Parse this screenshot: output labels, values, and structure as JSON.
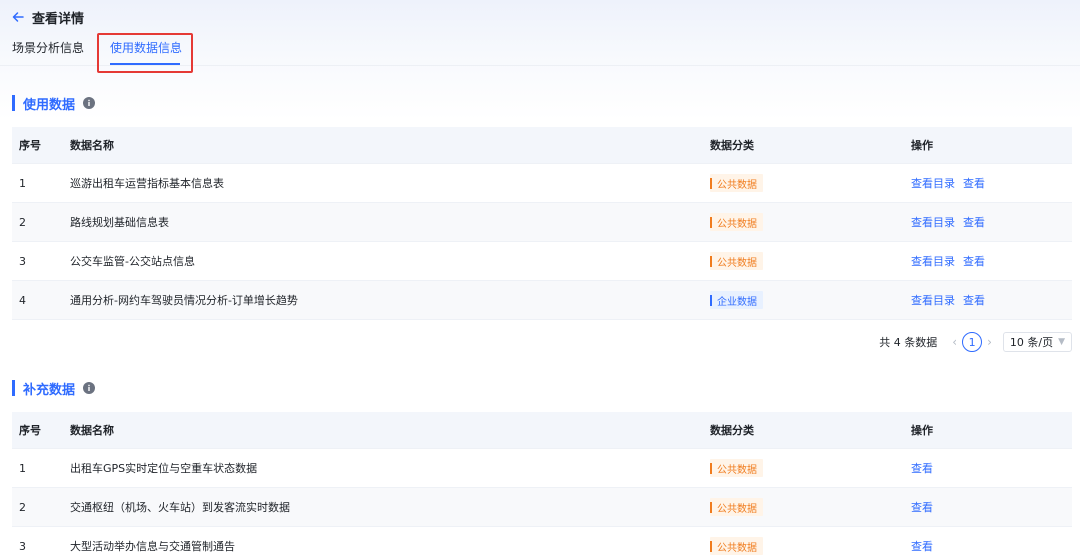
{
  "header": {
    "title": "查看详情"
  },
  "tabs": [
    {
      "label": "场景分析信息"
    },
    {
      "label": "使用数据信息"
    }
  ],
  "colors": {
    "accent": "#2f6bff",
    "public_tag": "#f07c1e",
    "highlight": "#e53935"
  },
  "usage": {
    "title": "使用数据",
    "columns": {
      "seq": "序号",
      "name": "数据名称",
      "category": "数据分类",
      "action": "操作"
    },
    "rows": [
      {
        "seq": "1",
        "name": "巡游出租车运营指标基本信息表",
        "category": "公共数据",
        "actions": [
          "查看目录",
          "查看"
        ]
      },
      {
        "seq": "2",
        "name": "路线规划基础信息表",
        "category": "公共数据",
        "actions": [
          "查看目录",
          "查看"
        ]
      },
      {
        "seq": "3",
        "name": "公交车监管-公交站点信息",
        "category": "公共数据",
        "actions": [
          "查看目录",
          "查看"
        ]
      },
      {
        "seq": "4",
        "name": "通用分析-网约车驾驶员情况分析-订单增长趋势",
        "category": "企业数据",
        "actions": [
          "查看目录",
          "查看"
        ]
      }
    ],
    "pagination": {
      "total_text": "共 4 条数据",
      "current_page": "1",
      "page_size": "10 条/页"
    }
  },
  "supplement": {
    "title": "补充数据",
    "columns": {
      "seq": "序号",
      "name": "数据名称",
      "category": "数据分类",
      "action": "操作"
    },
    "rows": [
      {
        "seq": "1",
        "name": "出租车GPS实时定位与空重车状态数据",
        "category": "公共数据",
        "actions": [
          "查看"
        ]
      },
      {
        "seq": "2",
        "name": "交通枢纽（机场、火车站）到发客流实时数据",
        "category": "公共数据",
        "actions": [
          "查看"
        ]
      },
      {
        "seq": "3",
        "name": "大型活动举办信息与交通管制通告",
        "category": "公共数据",
        "actions": [
          "查看"
        ]
      }
    ]
  }
}
